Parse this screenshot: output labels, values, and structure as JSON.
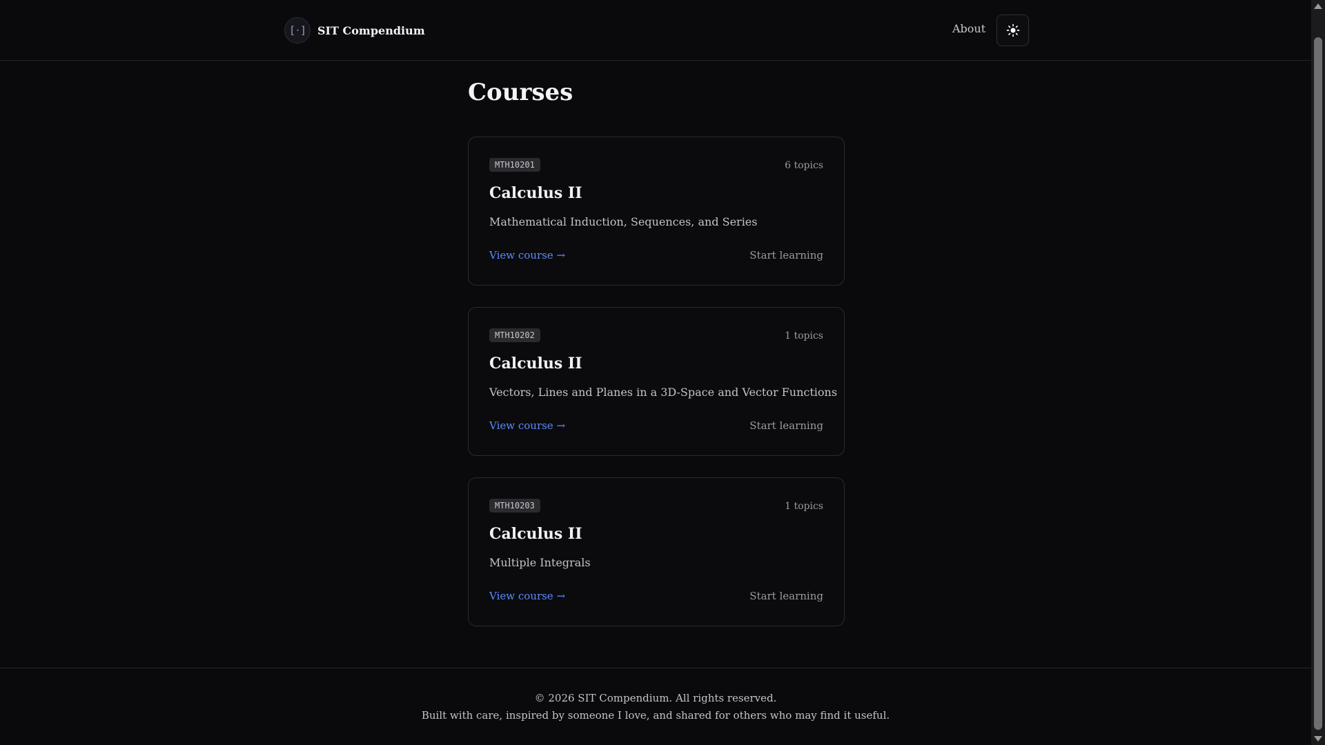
{
  "header": {
    "logo_text": "[·]",
    "brand": "SIT Compendium",
    "about": "About"
  },
  "main": {
    "title": "Courses",
    "courses": [
      {
        "code": "MTH10201",
        "topics": "6 topics",
        "name": "Calculus II",
        "description": "Mathematical Induction, Sequences, and Series",
        "view": "View course →",
        "start": "Start learning"
      },
      {
        "code": "MTH10202",
        "topics": "1 topics",
        "name": "Calculus II",
        "description": "Vectors, Lines and Planes in a 3D-Space and Vector Functions",
        "view": "View course →",
        "start": "Start learning"
      },
      {
        "code": "MTH10203",
        "topics": "1 topics",
        "name": "Calculus II",
        "description": "Multiple Integrals",
        "view": "View course →",
        "start": "Start learning"
      }
    ]
  },
  "footer": {
    "copyright": "© 2026 SIT Compendium. All rights reserved.",
    "tagline": "Built with care, inspired by someone I love, and shared for others who may find it useful."
  },
  "icons": {
    "theme_toggle": "sun-icon"
  },
  "colors": {
    "background": "#0a0a0c",
    "link": "#5b8cff",
    "border": "#2a2a30"
  }
}
